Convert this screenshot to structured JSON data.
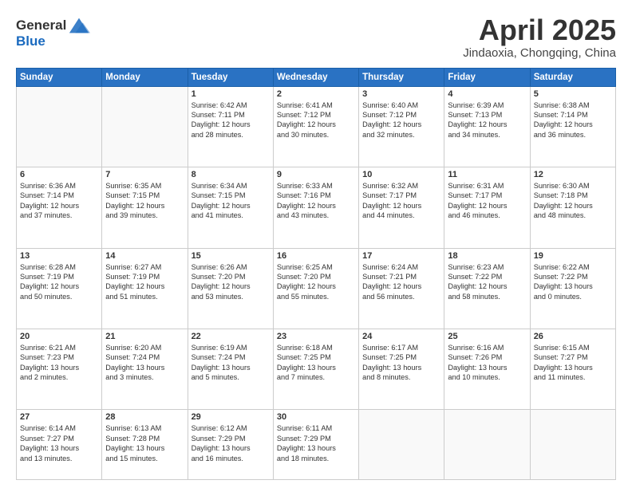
{
  "header": {
    "logo_line1": "General",
    "logo_line2": "Blue",
    "month_title": "April 2025",
    "location": "Jindaoxia, Chongqing, China"
  },
  "days_of_week": [
    "Sunday",
    "Monday",
    "Tuesday",
    "Wednesday",
    "Thursday",
    "Friday",
    "Saturday"
  ],
  "weeks": [
    [
      {
        "day": "",
        "info": ""
      },
      {
        "day": "",
        "info": ""
      },
      {
        "day": "1",
        "info": "Sunrise: 6:42 AM\nSunset: 7:11 PM\nDaylight: 12 hours\nand 28 minutes."
      },
      {
        "day": "2",
        "info": "Sunrise: 6:41 AM\nSunset: 7:12 PM\nDaylight: 12 hours\nand 30 minutes."
      },
      {
        "day": "3",
        "info": "Sunrise: 6:40 AM\nSunset: 7:12 PM\nDaylight: 12 hours\nand 32 minutes."
      },
      {
        "day": "4",
        "info": "Sunrise: 6:39 AM\nSunset: 7:13 PM\nDaylight: 12 hours\nand 34 minutes."
      },
      {
        "day": "5",
        "info": "Sunrise: 6:38 AM\nSunset: 7:14 PM\nDaylight: 12 hours\nand 36 minutes."
      }
    ],
    [
      {
        "day": "6",
        "info": "Sunrise: 6:36 AM\nSunset: 7:14 PM\nDaylight: 12 hours\nand 37 minutes."
      },
      {
        "day": "7",
        "info": "Sunrise: 6:35 AM\nSunset: 7:15 PM\nDaylight: 12 hours\nand 39 minutes."
      },
      {
        "day": "8",
        "info": "Sunrise: 6:34 AM\nSunset: 7:15 PM\nDaylight: 12 hours\nand 41 minutes."
      },
      {
        "day": "9",
        "info": "Sunrise: 6:33 AM\nSunset: 7:16 PM\nDaylight: 12 hours\nand 43 minutes."
      },
      {
        "day": "10",
        "info": "Sunrise: 6:32 AM\nSunset: 7:17 PM\nDaylight: 12 hours\nand 44 minutes."
      },
      {
        "day": "11",
        "info": "Sunrise: 6:31 AM\nSunset: 7:17 PM\nDaylight: 12 hours\nand 46 minutes."
      },
      {
        "day": "12",
        "info": "Sunrise: 6:30 AM\nSunset: 7:18 PM\nDaylight: 12 hours\nand 48 minutes."
      }
    ],
    [
      {
        "day": "13",
        "info": "Sunrise: 6:28 AM\nSunset: 7:19 PM\nDaylight: 12 hours\nand 50 minutes."
      },
      {
        "day": "14",
        "info": "Sunrise: 6:27 AM\nSunset: 7:19 PM\nDaylight: 12 hours\nand 51 minutes."
      },
      {
        "day": "15",
        "info": "Sunrise: 6:26 AM\nSunset: 7:20 PM\nDaylight: 12 hours\nand 53 minutes."
      },
      {
        "day": "16",
        "info": "Sunrise: 6:25 AM\nSunset: 7:20 PM\nDaylight: 12 hours\nand 55 minutes."
      },
      {
        "day": "17",
        "info": "Sunrise: 6:24 AM\nSunset: 7:21 PM\nDaylight: 12 hours\nand 56 minutes."
      },
      {
        "day": "18",
        "info": "Sunrise: 6:23 AM\nSunset: 7:22 PM\nDaylight: 12 hours\nand 58 minutes."
      },
      {
        "day": "19",
        "info": "Sunrise: 6:22 AM\nSunset: 7:22 PM\nDaylight: 13 hours\nand 0 minutes."
      }
    ],
    [
      {
        "day": "20",
        "info": "Sunrise: 6:21 AM\nSunset: 7:23 PM\nDaylight: 13 hours\nand 2 minutes."
      },
      {
        "day": "21",
        "info": "Sunrise: 6:20 AM\nSunset: 7:24 PM\nDaylight: 13 hours\nand 3 minutes."
      },
      {
        "day": "22",
        "info": "Sunrise: 6:19 AM\nSunset: 7:24 PM\nDaylight: 13 hours\nand 5 minutes."
      },
      {
        "day": "23",
        "info": "Sunrise: 6:18 AM\nSunset: 7:25 PM\nDaylight: 13 hours\nand 7 minutes."
      },
      {
        "day": "24",
        "info": "Sunrise: 6:17 AM\nSunset: 7:25 PM\nDaylight: 13 hours\nand 8 minutes."
      },
      {
        "day": "25",
        "info": "Sunrise: 6:16 AM\nSunset: 7:26 PM\nDaylight: 13 hours\nand 10 minutes."
      },
      {
        "day": "26",
        "info": "Sunrise: 6:15 AM\nSunset: 7:27 PM\nDaylight: 13 hours\nand 11 minutes."
      }
    ],
    [
      {
        "day": "27",
        "info": "Sunrise: 6:14 AM\nSunset: 7:27 PM\nDaylight: 13 hours\nand 13 minutes."
      },
      {
        "day": "28",
        "info": "Sunrise: 6:13 AM\nSunset: 7:28 PM\nDaylight: 13 hours\nand 15 minutes."
      },
      {
        "day": "29",
        "info": "Sunrise: 6:12 AM\nSunset: 7:29 PM\nDaylight: 13 hours\nand 16 minutes."
      },
      {
        "day": "30",
        "info": "Sunrise: 6:11 AM\nSunset: 7:29 PM\nDaylight: 13 hours\nand 18 minutes."
      },
      {
        "day": "",
        "info": ""
      },
      {
        "day": "",
        "info": ""
      },
      {
        "day": "",
        "info": ""
      }
    ]
  ]
}
